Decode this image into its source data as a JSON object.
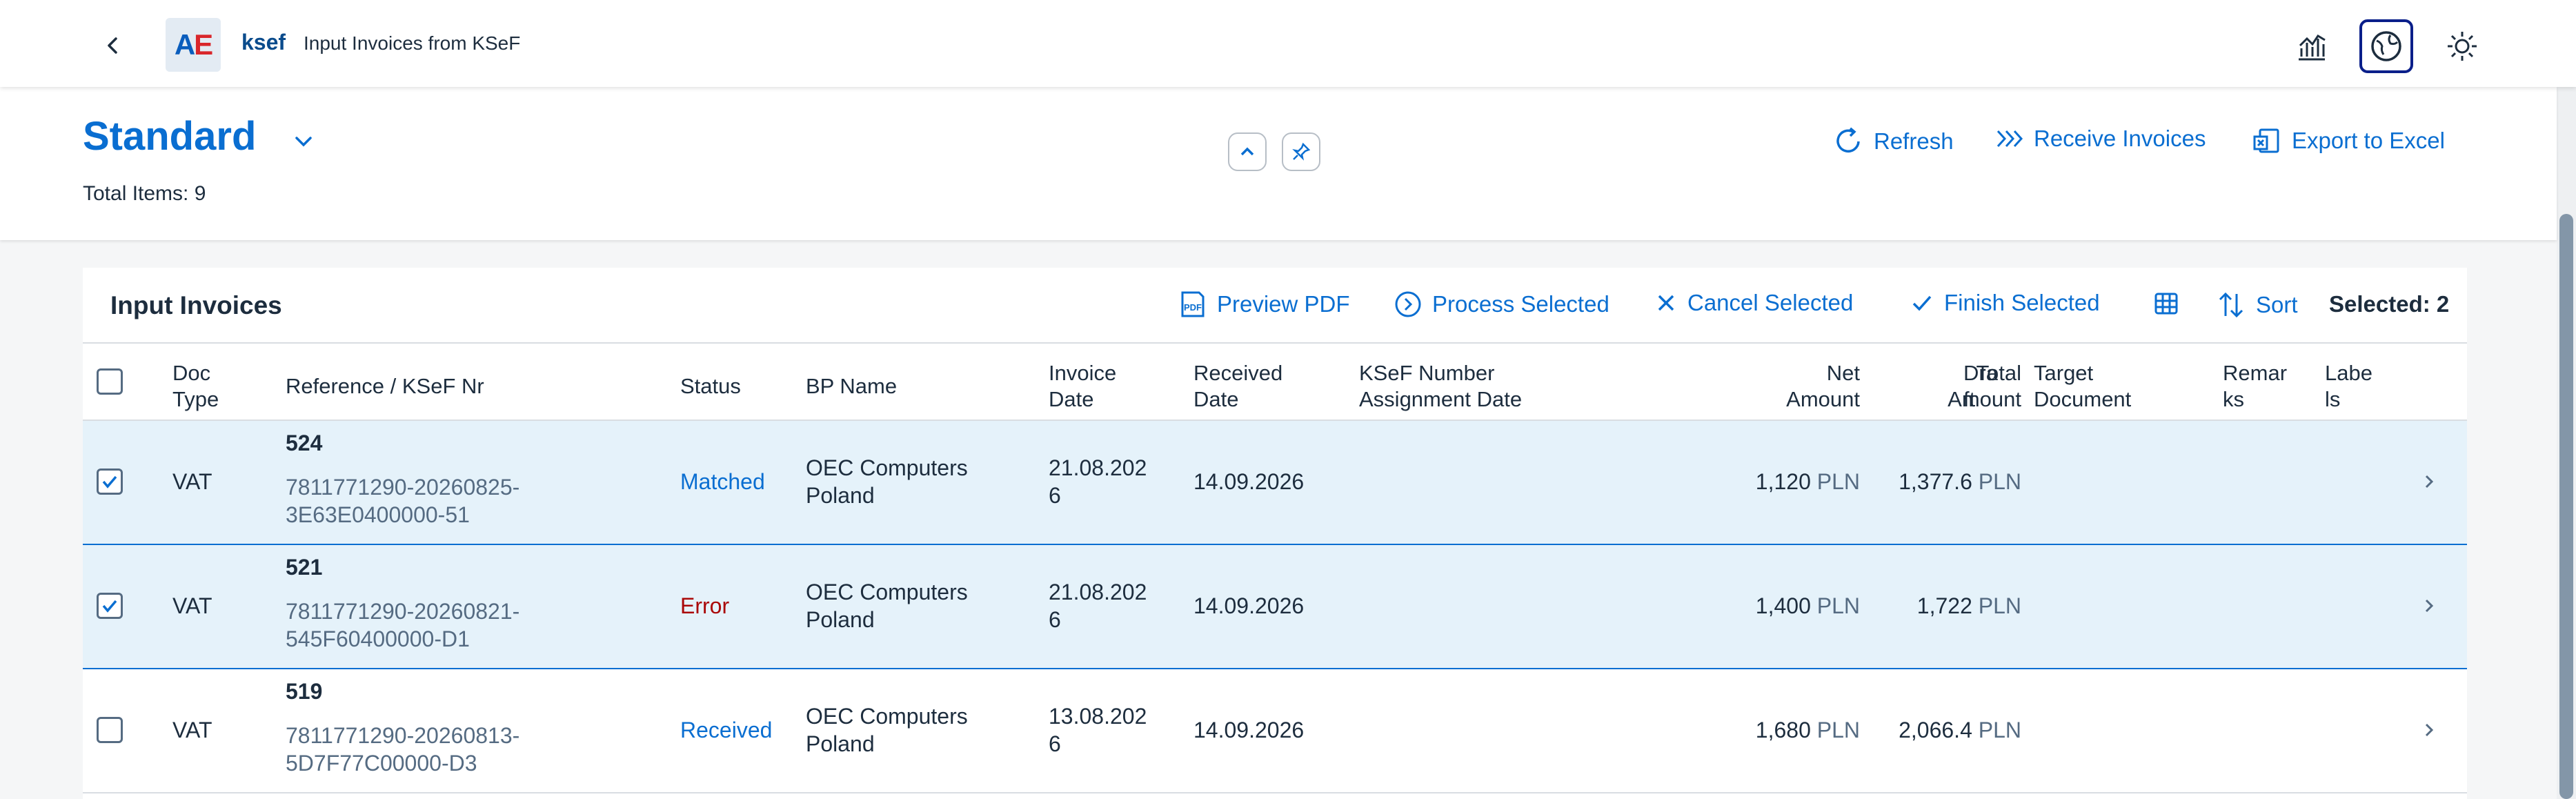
{
  "shell": {
    "logo_a": "A",
    "logo_e": "E",
    "app_name": "ksef",
    "app_subtitle": "Input Invoices from KSeF"
  },
  "header": {
    "variant": "Standard",
    "total_items": "Total Items: 9",
    "actions": {
      "refresh": "Refresh",
      "receive": "Receive Invoices",
      "export": "Export to Excel"
    }
  },
  "table": {
    "title": "Input Invoices",
    "toolbar": {
      "preview_pdf": "Preview PDF",
      "pdf_icon_text": "PDF",
      "process": "Process Selected",
      "cancel": "Cancel Selected",
      "finish": "Finish Selected",
      "sort": "Sort",
      "selected": "Selected: 2"
    },
    "columns": {
      "doc_type_1": "Doc",
      "doc_type_2": "Type",
      "reference": "Reference / KSeF Nr",
      "status": "Status",
      "bp_name": "BP Name",
      "invoice_date_1": "Invoice",
      "invoice_date_2": "Date",
      "received_date_1": "Received",
      "received_date_2": "Date",
      "ksef_assign_1": "KSeF Number",
      "ksef_assign_2": "Assignment Date",
      "net_1": "Net",
      "net_2": "Amount",
      "total_1": "Total",
      "total_2": "Amount",
      "draft_1": "Dra",
      "draft_2": "ft",
      "target_1": "Target",
      "target_2": "Document",
      "remarks_1": "Remar",
      "remarks_2": "ks",
      "labels_1": "Labe",
      "labels_2": "ls"
    },
    "rows": [
      {
        "selected": true,
        "doc_type": "VAT",
        "ref_no": "524",
        "ksef_1": "7811771290-20260825-",
        "ksef_2": "3E63E0400000-51",
        "status": "Matched",
        "status_color": "#0a6ed1",
        "bp_1": "OEC Computers",
        "bp_2": "Poland",
        "inv_date_1": "21.08.202",
        "inv_date_2": "6",
        "received": "14.09.2026",
        "net": "1,120",
        "net_cur": "PLN",
        "total": "1,377.6",
        "total_cur": "PLN"
      },
      {
        "selected": true,
        "doc_type": "VAT",
        "ref_no": "521",
        "ksef_1": "7811771290-20260821-",
        "ksef_2": "545F60400000-D1",
        "status": "Error",
        "status_color": "#aa0808",
        "bp_1": "OEC Computers",
        "bp_2": "Poland",
        "inv_date_1": "21.08.202",
        "inv_date_2": "6",
        "received": "14.09.2026",
        "net": "1,400",
        "net_cur": "PLN",
        "total": "1,722",
        "total_cur": "PLN"
      },
      {
        "selected": false,
        "doc_type": "VAT",
        "ref_no": "519",
        "ksef_1": "7811771290-20260813-",
        "ksef_2": "5D7F77C00000-D3",
        "status": "Received",
        "status_color": "#0a6ed1",
        "bp_1": "OEC Computers",
        "bp_2": "Poland",
        "inv_date_1": "13.08.202",
        "inv_date_2": "6",
        "received": "14.09.2026",
        "net": "1,680",
        "net_cur": "PLN",
        "total": "2,066.4",
        "total_cur": "PLN"
      }
    ]
  },
  "icons": {
    "back": "chevron-left-icon",
    "analytics": "analytics-icon",
    "globe": "globe-icon",
    "theme": "sun-icon"
  },
  "colors": {
    "accent": "#0a6ed1",
    "selected_row": "#e5f2fa",
    "error": "#aa0808"
  }
}
